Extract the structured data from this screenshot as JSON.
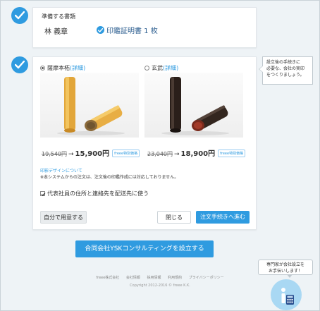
{
  "step1": {
    "label": "準備する書類",
    "name": "林 義章",
    "document": "印鑑証明書 1 枚"
  },
  "step2": {
    "option1": {
      "name": "薩摩本柘",
      "detail_link": "(詳細)",
      "old_price": "19,540円",
      "arrow": "→",
      "new_price": "15,900円",
      "badge": "freee特別価格",
      "selected": true
    },
    "option2": {
      "name": "玄武",
      "detail_link": "(詳細)",
      "old_price": "23,040円",
      "arrow": "→",
      "new_price": "18,900円",
      "badge": "freee特別価格",
      "selected": false
    },
    "design_link": "印影デザインについて",
    "notice": "※本システムからの注文は、注文後の印鑑作成には対応しておりません。",
    "checkbox_label": "代表社員の住所と連絡先を配送先に使う",
    "checkbox_checked": true,
    "self_prepare_button": "自分で用意する",
    "close_button": "閉じる",
    "proceed_button": "注文手続きへ進む"
  },
  "tooltip": {
    "line1": "設立後の手続きに",
    "line2": "必要な、会社の実印",
    "line3": "をつくりましょう。"
  },
  "cta_button": "合同会社YSKコンサルティングを設立する",
  "footer": {
    "links": [
      "freee株式会社",
      "会社情報",
      "採用情報",
      "利用規約",
      "プライバシーポリシー"
    ],
    "copyright": "Copyright 2012-2016 © freee K.K."
  },
  "help": {
    "line1": "専門家が会社設立を",
    "line2": "お手伝いします！"
  },
  "colors": {
    "accent": "#2f9be0",
    "background": "#eef3f6"
  },
  "icons": {
    "step1": "check-circle-icon",
    "step2": "check-circle-icon",
    "document": "check-icon",
    "help": "advisor-calculator-icon"
  }
}
